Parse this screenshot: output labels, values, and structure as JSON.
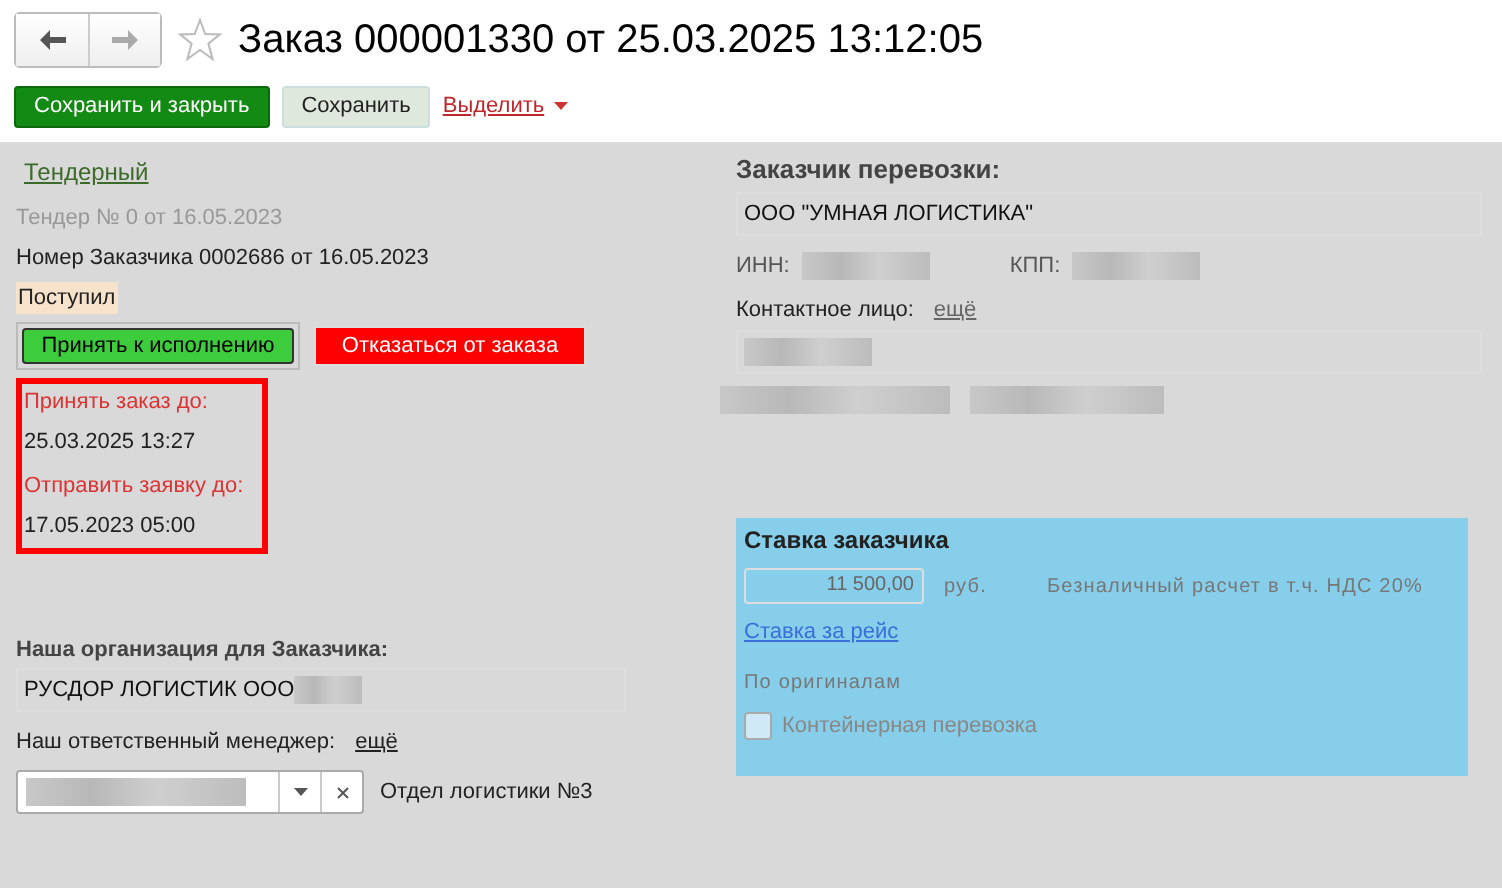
{
  "header": {
    "title": "Заказ 000001330 от 25.03.2025 13:12:05",
    "favorite": false
  },
  "toolbar": {
    "save_close": "Сохранить и закрыть",
    "save": "Сохранить",
    "select": "Выделить"
  },
  "left": {
    "type_link": "Тендерный",
    "tender": "Тендер № 0 от 16.05.2023",
    "customer_number": "Номер Заказчика 0002686 от 16.05.2023",
    "status": "Поступил",
    "accept_button": "Принять к исполнению",
    "reject_button": "Отказаться от заказа",
    "deadlines": [
      {
        "label": "Принять заказ до:",
        "value": "25.03.2025 13:27"
      },
      {
        "label": "Отправить заявку до:",
        "value": "17.05.2023 05:00"
      }
    ],
    "org_heading": "Наша организация для Заказчика:",
    "org_name": "РУСДОР ЛОГИСТИК ООО",
    "manager_label": "Наш ответственный менеджер:",
    "manager_more": "ещё",
    "department": "Отдел логистики №3"
  },
  "right": {
    "heading": "Заказчик перевозки:",
    "customer": "ООО \"УМНАЯ ЛОГИСТИКА\"",
    "inn_label": "ИНН:",
    "kpp_label": "КПП:",
    "contact_label": "Контактное лицо:",
    "contact_more": "ещё",
    "rate": {
      "heading": "Ставка заказчика",
      "amount": "11 500,00",
      "currency": "руб.",
      "payment": "Безналичный расчет в т.ч. НДС 20%",
      "rate_link": "Ставка за рейс",
      "originals": "По оригиналам",
      "container": {
        "label": "Контейнерная перевозка",
        "checked": false
      }
    }
  }
}
